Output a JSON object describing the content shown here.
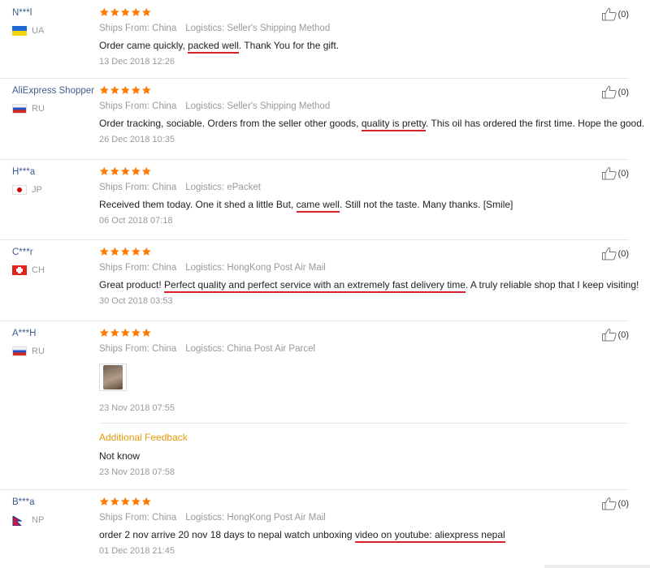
{
  "reviews": [
    {
      "user": "N***l",
      "country": "UA",
      "ships_from": "Ships From: China",
      "logistics": "Logistics: Seller's Shipping Method",
      "text": [
        {
          "t": "Order came quickly, "
        },
        {
          "t": "packed well",
          "hl": true
        },
        {
          "t": ". Thank You for the gift."
        }
      ],
      "date": "13 Dec 2018 12:26",
      "helpful": "(0)"
    },
    {
      "user": "AliExpress Shopper",
      "country": "RU",
      "ships_from": "Ships From: China",
      "logistics": "Logistics: Seller's Shipping Method",
      "text": [
        {
          "t": "Order tracking, sociable. Orders from the seller other goods, "
        },
        {
          "t": "quality is pretty",
          "hl": true
        },
        {
          "t": ". This oil has ordered the first time. Hope the good."
        }
      ],
      "date": "26 Dec 2018 10:35",
      "helpful": "(0)"
    },
    {
      "user": "H***a",
      "country": "JP",
      "ships_from": "Ships From: China",
      "logistics": "Logistics: ePacket",
      "text": [
        {
          "t": "Received them today. One it shed a little But, "
        },
        {
          "t": "came well",
          "hl": true
        },
        {
          "t": ". Still not the taste. Many thanks. [Smile]"
        }
      ],
      "date": "06 Oct 2018 07:18",
      "helpful": "(0)"
    },
    {
      "user": "C***r",
      "country": "CH",
      "ships_from": "Ships From: China",
      "logistics": "Logistics: HongKong Post Air Mail",
      "text": [
        {
          "t": "Great product! "
        },
        {
          "t": "Perfect quality and perfect service with an extremely fast delivery time",
          "hl": true
        },
        {
          "t": ". A truly reliable shop that I keep visiting!"
        }
      ],
      "date": "30 Oct 2018 03:53",
      "helpful": "(0)"
    },
    {
      "user": "A***H",
      "country": "RU",
      "ships_from": "Ships From: China",
      "logistics": "Logistics: China Post Air Parcel",
      "date": "23 Nov 2018 07:55",
      "helpful": "(0)",
      "additional_feedback": {
        "label": "Additional Feedback",
        "text": "Not know",
        "date": "23 Nov 2018 07:58"
      }
    },
    {
      "user": "B***a",
      "country": "NP",
      "ships_from": "Ships From: China",
      "logistics": "Logistics: HongKong Post Air Mail",
      "text": [
        {
          "t": "order 2 nov arrive 20 nov 18 days to nepal watch unboxing "
        },
        {
          "t": "video on youtube: aliexpress nepal",
          "hl": true
        }
      ],
      "date": "01 Dec 2018 21:45",
      "helpful": "(0)"
    }
  ],
  "colors": {
    "star": "#ff7a00",
    "highlight_underline": "#d7222a",
    "feedback_label": "#e8990c",
    "username": "#3d5c8a"
  },
  "icons": {
    "rating": "star-icon",
    "helpful": "thumbs-up-icon",
    "photo": "review-photo-thumbnail"
  }
}
